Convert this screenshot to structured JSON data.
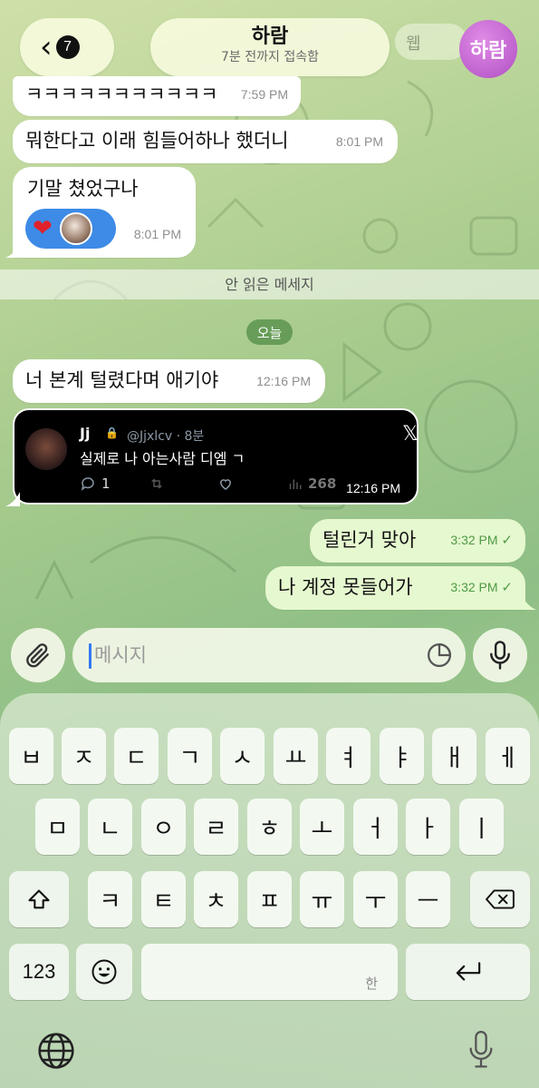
{
  "header": {
    "back_badge": "7",
    "contact_name": "하람",
    "last_seen": "7분 전까지 접속함",
    "avatar_text": "하람",
    "avatar_color": "#c56ad7",
    "ghost_text": "웹"
  },
  "messages": [
    {
      "text": "ㅋㅋㅋㅋㅋㅋㅋㅋㅋㅋㅋ",
      "time": "7:59 PM",
      "dir": "in"
    },
    {
      "text": "뭐한다고 이래 힘들어하나 했더니",
      "time": "8:01 PM",
      "dir": "in"
    },
    {
      "text": "기말 쳤었구나",
      "time": "8:01 PM",
      "dir": "in",
      "reaction": "heart"
    },
    {
      "text": "너 본계 털렸다며 애기야",
      "time": "12:16 PM",
      "dir": "in"
    },
    {
      "text": "털린거 맞아",
      "time": "3:32 PM",
      "dir": "out",
      "status": "✓"
    },
    {
      "text": "나 계정 못들어가",
      "time": "3:32 PM",
      "dir": "out",
      "status": "✓"
    }
  ],
  "unread_divider": "안 읽은 메세지",
  "date_chip": "오늘",
  "tweet": {
    "name": "Jj",
    "handle": "@Jjxlcv · 8분",
    "text": "실제로 나 아는사람 디엠 ㄱ",
    "replies": "1",
    "views": "268",
    "time": "12:16 PM",
    "logo": "𝕏"
  },
  "composer": {
    "placeholder": "메시지"
  },
  "keyboard": {
    "row1": [
      "ㅂ",
      "ㅈ",
      "ㄷ",
      "ㄱ",
      "ㅅ",
      "ㅛ",
      "ㅕ",
      "ㅑ",
      "ㅐ",
      "ㅔ"
    ],
    "row2": [
      "ㅁ",
      "ㄴ",
      "ㅇ",
      "ㄹ",
      "ㅎ",
      "ㅗ",
      "ㅓ",
      "ㅏ",
      "ㅣ"
    ],
    "row3": [
      "ㅋ",
      "ㅌ",
      "ㅊ",
      "ㅍ",
      "ㅠ",
      "ㅜ",
      "ㅡ"
    ],
    "numbers_label": "123",
    "space_hint": "한",
    "shift_icon": "shift-icon",
    "delete_icon": "delete-icon",
    "return_icon": "return-icon",
    "emoji_icon": "emoji-icon",
    "globe_icon": "globe-icon",
    "dictation_icon": "microphone-icon"
  },
  "colors": {
    "outgoing_bubble": "#e6f8cf",
    "incoming_bubble": "#ffffff",
    "checkmark": "#4e9b45",
    "reaction_bg": "#3d8be6",
    "date_chip_bg": "#5a9a4e"
  }
}
